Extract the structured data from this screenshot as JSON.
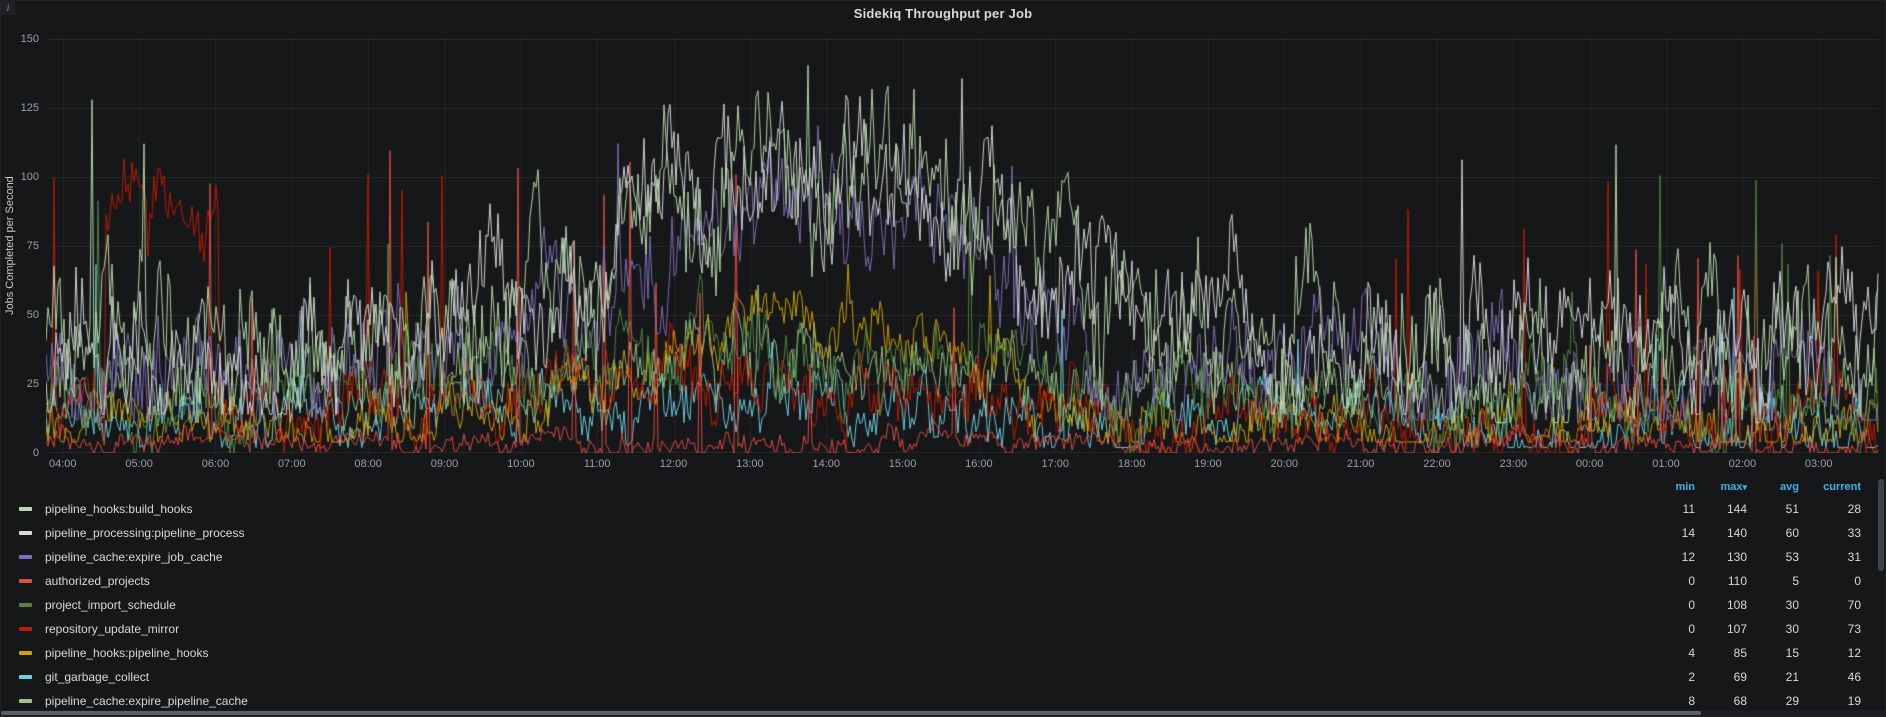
{
  "panel": {
    "title": "Sidekiq Throughput per Job",
    "info_icon_label": "i"
  },
  "colors": {
    "background": "#161719",
    "grid": "rgba(255,255,255,0.08)",
    "grid_vertical": "rgba(255,255,255,0.06)",
    "axis_text": "#9aa0a6",
    "title_text": "#d8d9da",
    "legend_header": "#33b5e5",
    "legend_text": "#d8d9da"
  },
  "chart_data": {
    "type": "line",
    "title": "Sidekiq Throughput per Job",
    "xlabel": "",
    "ylabel": "Jobs Completed per Second",
    "ylim": [
      0,
      150
    ],
    "y_ticks": [
      0,
      25,
      50,
      75,
      100,
      125,
      150
    ],
    "x_ticks": [
      "04:00",
      "05:00",
      "06:00",
      "07:00",
      "08:00",
      "09:00",
      "10:00",
      "11:00",
      "12:00",
      "13:00",
      "14:00",
      "15:00",
      "16:00",
      "17:00",
      "18:00",
      "19:00",
      "20:00",
      "21:00",
      "22:00",
      "23:00",
      "00:00",
      "01:00",
      "02:00",
      "03:00"
    ],
    "x_start_hour": 3.78,
    "x_end_hour": 27.79,
    "grid": true,
    "legend": {
      "position": "bottom",
      "type": "table",
      "columns": [
        {
          "label": "min"
        },
        {
          "label": "max",
          "sort": "desc"
        },
        {
          "label": "avg"
        },
        {
          "label": "current"
        }
      ]
    },
    "series": [
      {
        "name": "pipeline_hooks:build_hooks",
        "color": "#B7DBAB",
        "min": 11,
        "max": 144,
        "avg": 51,
        "current": 28,
        "render_hints": {
          "base": 34,
          "hump": 72,
          "hump_center": 14.2,
          "hump_width": 3.6,
          "noise": 28,
          "spike_prob": 0.004,
          "spike_floor": 105,
          "late_factor": 0.5
        }
      },
      {
        "name": "pipeline_processing:pipeline_process",
        "color": "#D8D9DA",
        "min": 14,
        "max": 140,
        "avg": 60,
        "current": 33,
        "render_hints": {
          "base": 36,
          "hump": 68,
          "hump_center": 13.9,
          "hump_width": 3.4,
          "noise": 24,
          "spike_prob": 0.003,
          "spike_floor": 100,
          "late_factor": 0.5
        }
      },
      {
        "name": "pipeline_cache:expire_job_cache",
        "color": "#806EB7",
        "min": 12,
        "max": 130,
        "avg": 53,
        "current": 31,
        "render_hints": {
          "base": 26,
          "hump": 66,
          "hump_center": 13.7,
          "hump_width": 3.1,
          "noise": 22,
          "spike_prob": 0.003,
          "spike_floor": 95,
          "late_factor": 0.5
        }
      },
      {
        "name": "authorized_projects",
        "color": "#E24D42",
        "min": 0,
        "max": 110,
        "avg": 5,
        "current": 0,
        "render_hints": {
          "base": 3,
          "hump": 0,
          "hump_center": 14,
          "hump_width": 4,
          "noise": 5,
          "spike_prob": 0.02,
          "spike_floor": 30,
          "late_factor": 2.2
        }
      },
      {
        "name": "project_import_schedule",
        "color": "#508642",
        "min": 0,
        "max": 108,
        "avg": 30,
        "current": 70,
        "render_hints": {
          "base": 20,
          "hump": 16,
          "hump_center": 13.5,
          "hump_width": 4.5,
          "noise": 16,
          "spike_prob": 0.013,
          "spike_floor": 55,
          "late_factor": 1.6
        }
      },
      {
        "name": "repository_update_mirror",
        "color": "#BF1B00",
        "min": 0,
        "max": 107,
        "avg": 30,
        "current": 73,
        "render_hints": {
          "base": 16,
          "hump": 10,
          "hump_center": 13,
          "hump_width": 5,
          "noise": 14,
          "plateau": [
            4.55,
            6.05,
            90
          ],
          "spike_prob": 0.012,
          "spike_floor": 60,
          "late_factor": 3.5
        }
      },
      {
        "name": "pipeline_hooks:pipeline_hooks",
        "color": "#CCA300",
        "min": 4,
        "max": 85,
        "avg": 15,
        "current": 12,
        "render_hints": {
          "base": 8,
          "hump": 40,
          "hump_center": 13.8,
          "hump_width": 3.0,
          "noise": 12,
          "spike_prob": 0.006,
          "spike_floor": 45,
          "late_factor": 1
        }
      },
      {
        "name": "git_garbage_collect",
        "color": "#6ED0E0",
        "min": 2,
        "max": 69,
        "avg": 21,
        "current": 46,
        "render_hints": {
          "base": 10,
          "hump": 8,
          "hump_center": 13,
          "hump_width": 5,
          "noise": 12,
          "spike_prob": 0.012,
          "spike_floor": 35,
          "late_factor": 2.2
        }
      },
      {
        "name": "pipeline_cache:expire_pipeline_cache",
        "color": "#9AC48A",
        "min": 8,
        "max": 68,
        "avg": 29,
        "current": 19,
        "render_hints": {
          "base": 20,
          "hump": 16,
          "hump_center": 13.5,
          "hump_width": 4,
          "noise": 14,
          "spike_prob": 0.004,
          "spike_floor": 40,
          "late_factor": 1
        }
      }
    ]
  }
}
